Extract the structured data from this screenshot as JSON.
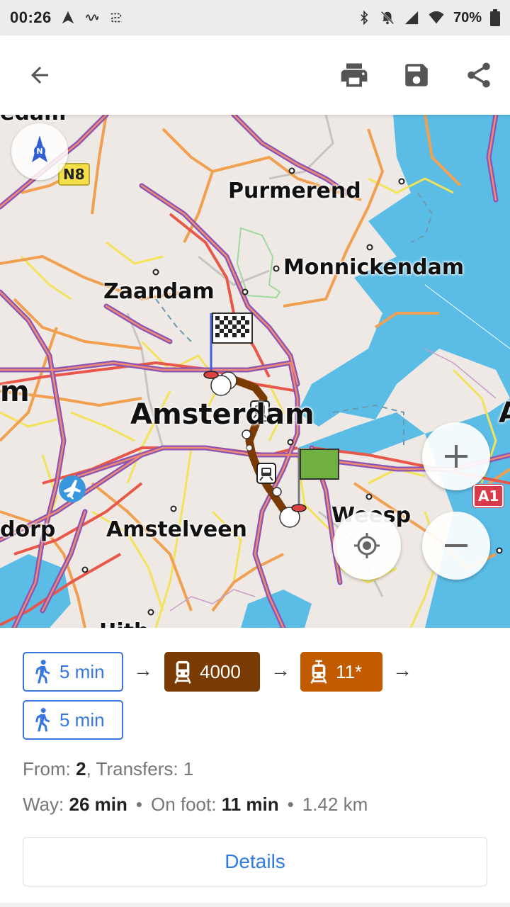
{
  "status_bar": {
    "time": "00:26",
    "battery": "70%"
  },
  "toolbar": {
    "icons": [
      "back-arrow-icon",
      "print-icon",
      "save-icon",
      "share-icon"
    ]
  },
  "map": {
    "labels": {
      "purmerend": "Purmerend",
      "monnickendam": "Monnickendam",
      "zaandam": "Zaandam",
      "amsterdam": "Amsterdam",
      "amstelveen": "Amstelveen",
      "weesp": "Weesp",
      "dorp": "dorp",
      "m_left": "m",
      "a_right": "A",
      "top_cut": "edam",
      "bottom_cut": "Uith"
    },
    "shields": {
      "n8": "N8",
      "a1": "A1"
    },
    "compass_letter": "N",
    "colors": {
      "water": "#5bbde6",
      "land": "#efe9e5",
      "route": "#7a3a04",
      "motorway": "#8a55b5",
      "primary": "#e8584a",
      "secondary": "#f0a050",
      "tertiary": "#f5e650"
    }
  },
  "route": {
    "segments": [
      {
        "type": "walk",
        "label": "5 min",
        "icon": "walk-icon"
      },
      {
        "type": "train",
        "label": "4000",
        "icon": "train-icon"
      },
      {
        "type": "tram",
        "label": "11*",
        "icon": "tram-icon"
      },
      {
        "type": "walk",
        "label": "5 min",
        "icon": "walk-icon"
      }
    ],
    "from_label": "From: ",
    "from_value": "2",
    "transfers_label": ", Transfers: 1",
    "way_label": "Way: ",
    "way_value": "26 min",
    "foot_label": "On foot: ",
    "foot_value": "11 min",
    "distance": "1.42 km",
    "details_label": "Details"
  }
}
